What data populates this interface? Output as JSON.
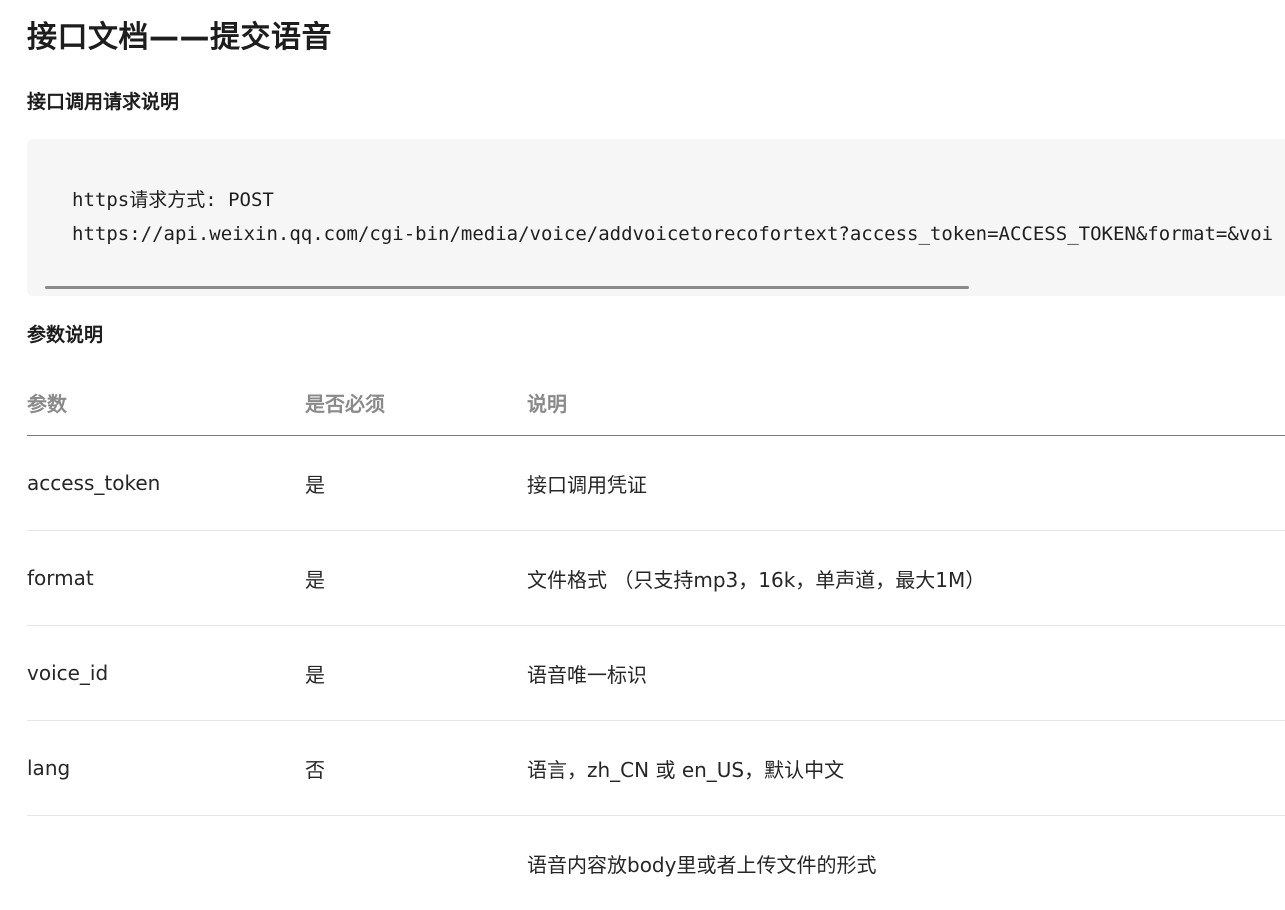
{
  "title": "接口文档——提交语音",
  "request_section": {
    "heading": "接口调用请求说明",
    "code": {
      "line1_prefix": "https",
      "line1_cjk": "请求方式",
      "line1_suffix": ": POST",
      "line2": "https://api.weixin.qq.com/cgi-bin/media/voice/addvoicetorecofortext?access_token=ACCESS_TOKEN&format=&voi"
    }
  },
  "params_section": {
    "heading": "参数说明",
    "table": {
      "headers": [
        "参数",
        "是否必须",
        "说明"
      ],
      "rows": [
        {
          "param": "access_token",
          "required": "是",
          "desc": "接口调用凭证"
        },
        {
          "param": "format",
          "required": "是",
          "desc": "文件格式 （只支持mp3，16k，单声道，最大1M）"
        },
        {
          "param": "voice_id",
          "required": "是",
          "desc": "语音唯一标识"
        },
        {
          "param": "lang",
          "required": "否",
          "desc": "语言，zh_CN 或 en_US，默认中文"
        },
        {
          "param": "",
          "required": "",
          "desc": "语音内容放body里或者上传文件的形式"
        }
      ]
    }
  }
}
